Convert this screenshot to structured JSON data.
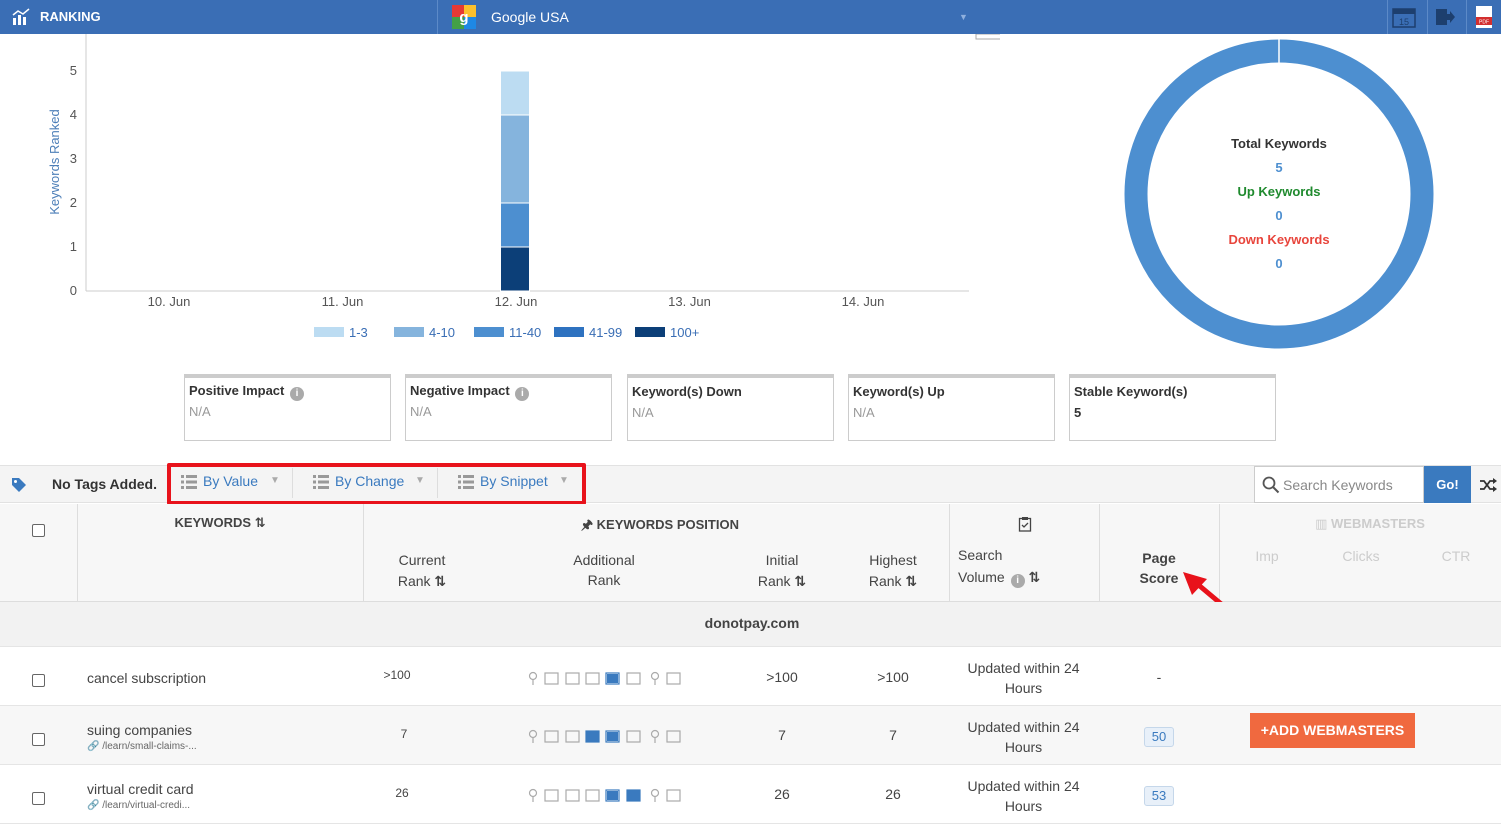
{
  "topbar": {
    "title": "RANKING",
    "engine": "Google USA"
  },
  "chart_data": {
    "type": "bar",
    "stacked": true,
    "categories": [
      "10. Jun",
      "11. Jun",
      "12. Jun",
      "13. Jun",
      "14. Jun"
    ],
    "ylabel": "Keywords Ranked",
    "ylim": [
      0,
      5
    ],
    "yticks": [
      "0",
      "1",
      "2",
      "3",
      "4",
      "5"
    ],
    "series": [
      {
        "name": "1-3",
        "color": "#bcdcf2",
        "values": [
          0,
          0,
          1,
          0,
          0
        ]
      },
      {
        "name": "4-10",
        "color": "#85b4dd",
        "values": [
          0,
          0,
          2,
          0,
          0
        ]
      },
      {
        "name": "11-40",
        "color": "#4d8fd0",
        "values": [
          0,
          0,
          1,
          0,
          0
        ]
      },
      {
        "name": "41-99",
        "color": "#2e72c0",
        "values": [
          0,
          0,
          0,
          0,
          0
        ]
      },
      {
        "name": "100+",
        "color": "#0c3f78",
        "values": [
          0,
          0,
          1,
          0,
          0
        ]
      }
    ],
    "legend_position": "bottom"
  },
  "donut": {
    "total_label": "Total Keywords",
    "total_value": "5",
    "up_label": "Up Keywords",
    "up_value": "0",
    "down_label": "Down Keywords",
    "down_value": "0",
    "color": "#4d8fd0"
  },
  "stats": [
    {
      "label": "Positive Impact",
      "value": "N/A"
    },
    {
      "label": "Negative Impact",
      "value": "N/A"
    },
    {
      "label": "Keyword(s) Down",
      "value": "N/A"
    },
    {
      "label": "Keyword(s) Up",
      "value": "N/A"
    },
    {
      "label": "Stable Keyword(s)",
      "value": "5"
    }
  ],
  "tagbar": {
    "no_tags": "No Tags Added.",
    "filters": [
      "By Value",
      "By Change",
      "By Snippet"
    ],
    "search_placeholder": "Search Keywords",
    "go": "Go!"
  },
  "table": {
    "keywords_header": "KEYWORDS",
    "position_header": "KEYWORDS POSITION",
    "current_rank_1": "Current",
    "current_rank_2": "Rank",
    "additional_rank_1": "Additional",
    "additional_rank_2": "Rank",
    "initial_rank_1": "Initial",
    "initial_rank_2": "Rank",
    "highest_rank_1": "Highest",
    "highest_rank_2": "Rank",
    "search_volume_1": "Search",
    "search_volume_2": "Volume",
    "page_score_1": "Page",
    "page_score_2": "Score",
    "webmasters": "WEBMASTERS",
    "imp": "Imp",
    "clicks": "Clicks",
    "ctr": "CTR",
    "domain": "donotpay.com",
    "add_webmasters": "+ADD WEBMASTERS",
    "rows": [
      {
        "keyword": "cancel subscription",
        "url": "",
        "current": ">100",
        "initial": ">100",
        "highest": ">100",
        "volume_1": "Updated within 24",
        "volume_2": "Hours",
        "score": "-"
      },
      {
        "keyword": "suing companies",
        "url": "/learn/small-claims-...",
        "current": "7",
        "initial": "7",
        "highest": "7",
        "volume_1": "Updated within 24",
        "volume_2": "Hours",
        "score": "50"
      },
      {
        "keyword": "virtual credit card",
        "url": "/learn/virtual-credi...",
        "current": "26",
        "initial": "26",
        "highest": "26",
        "volume_1": "Updated within 24",
        "volume_2": "Hours",
        "score": "53"
      }
    ]
  }
}
